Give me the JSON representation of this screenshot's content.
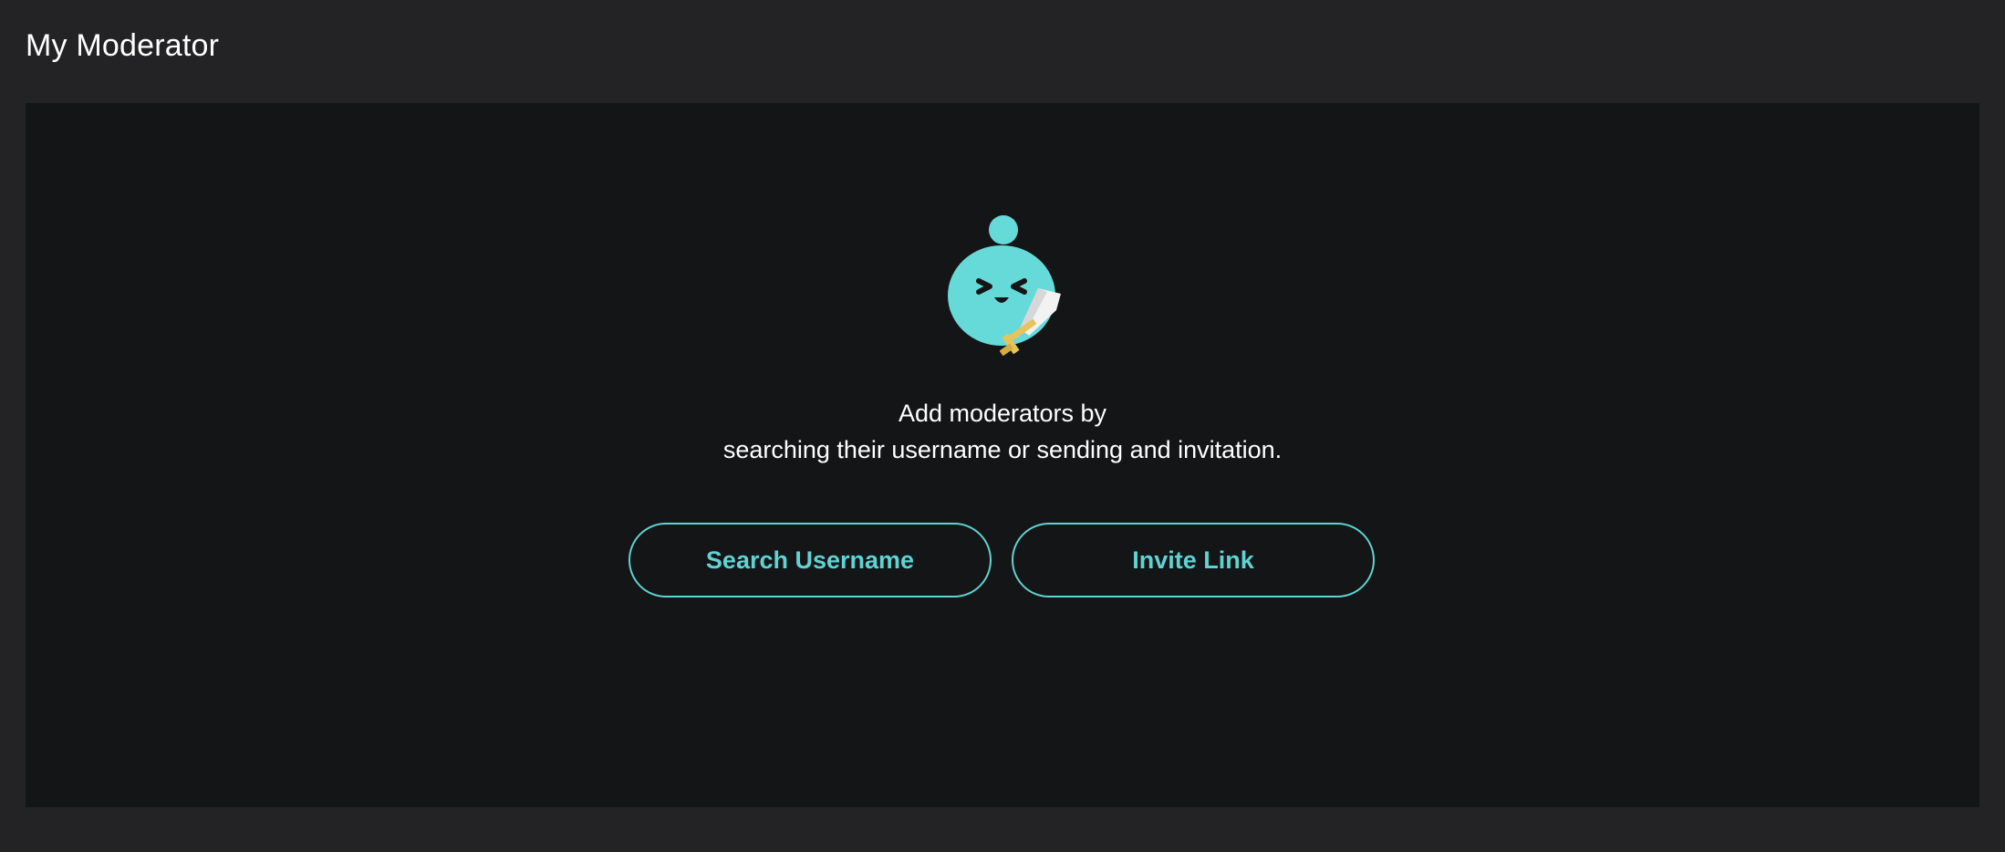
{
  "page": {
    "title": "My Moderator"
  },
  "empty_state": {
    "mascot_icon": "moderator-mascot-with-sword-icon",
    "message_line1": "Add moderators by",
    "message_line2": "searching their username or sending and invitation."
  },
  "actions": {
    "search_label": "Search Username",
    "invite_label": "Invite Link"
  },
  "colors": {
    "accent": "#5fd3d2",
    "background": "#232325",
    "panel": "#141517",
    "sword_blade": "#f2f2f2",
    "sword_hilt": "#e6c45a"
  }
}
